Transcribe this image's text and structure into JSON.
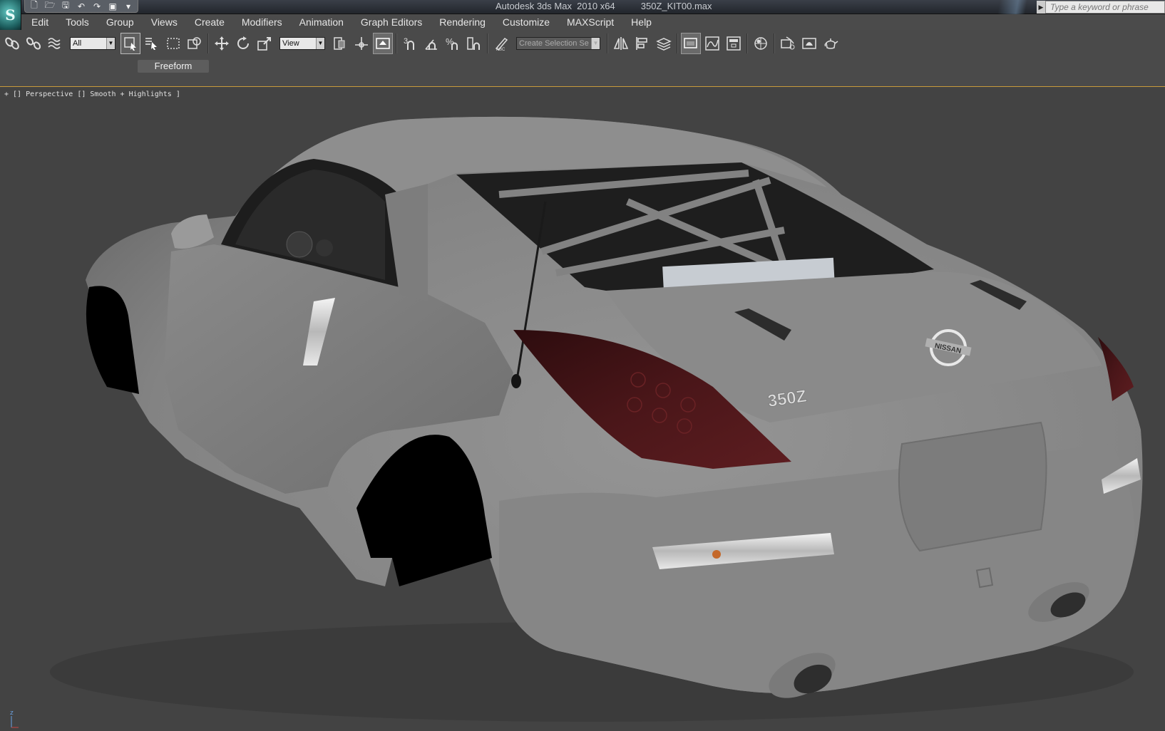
{
  "title_bar": {
    "app_title": "Autodesk 3ds Max  2010 x64",
    "file_name": "350Z_KIT00.max",
    "search_placeholder": "Type a keyword or phrase",
    "app_logo_glyph": "S",
    "quick_access": [
      {
        "name": "new-file-icon",
        "glyph": "🗋"
      },
      {
        "name": "open-folder-icon",
        "glyph": "🗁"
      },
      {
        "name": "save-icon",
        "glyph": "🖫"
      },
      {
        "name": "undo-icon",
        "glyph": "↶"
      },
      {
        "name": "redo-icon",
        "glyph": "↷"
      },
      {
        "name": "project-folder-icon",
        "glyph": "▣"
      },
      {
        "name": "dropdown-icon",
        "glyph": "▾"
      }
    ]
  },
  "menu": [
    "Edit",
    "Tools",
    "Group",
    "Views",
    "Create",
    "Modifiers",
    "Animation",
    "Graph Editors",
    "Rendering",
    "Customize",
    "MAXScript",
    "Help"
  ],
  "toolbar": {
    "selection_filter": "All",
    "reference_coord": "View",
    "named_selection": "Create Selection Se",
    "snap_label": "3"
  },
  "ribbon": {
    "active_tab": "Freeform"
  },
  "viewport": {
    "label": "+ [] Perspective [] Smooth + Highlights ]",
    "axis_z": "z",
    "badge_brand": "NISSAN",
    "badge_model": "350Z"
  },
  "colors": {
    "accent_border": "#c79a3b",
    "viewport_bg": "#434343",
    "car_body": "#8c8c8c",
    "taillight": "#3d1416"
  }
}
